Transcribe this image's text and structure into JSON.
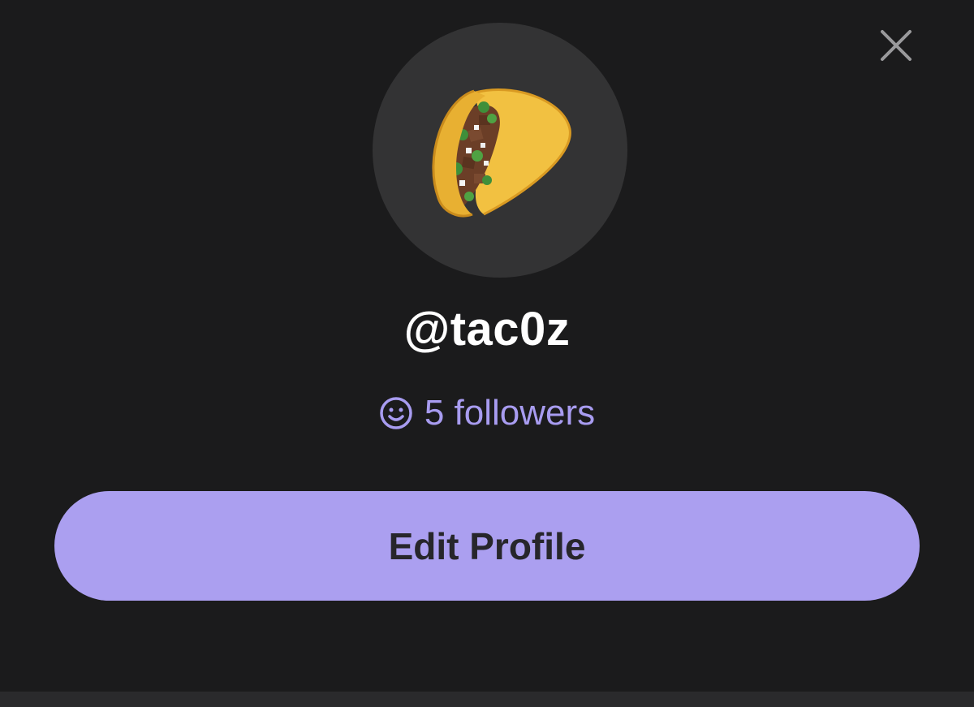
{
  "profile": {
    "username": "@tac0z",
    "followers_text": "5 followers",
    "edit_label": "Edit Profile",
    "avatar_emoji": "taco"
  },
  "icons": {
    "close": "close-icon",
    "followers": "smile-icon"
  },
  "colors": {
    "background": "#1b1b1c",
    "accent": "#ab9ff0",
    "followers_text": "#a89cf0",
    "avatar_bg": "#333334"
  }
}
